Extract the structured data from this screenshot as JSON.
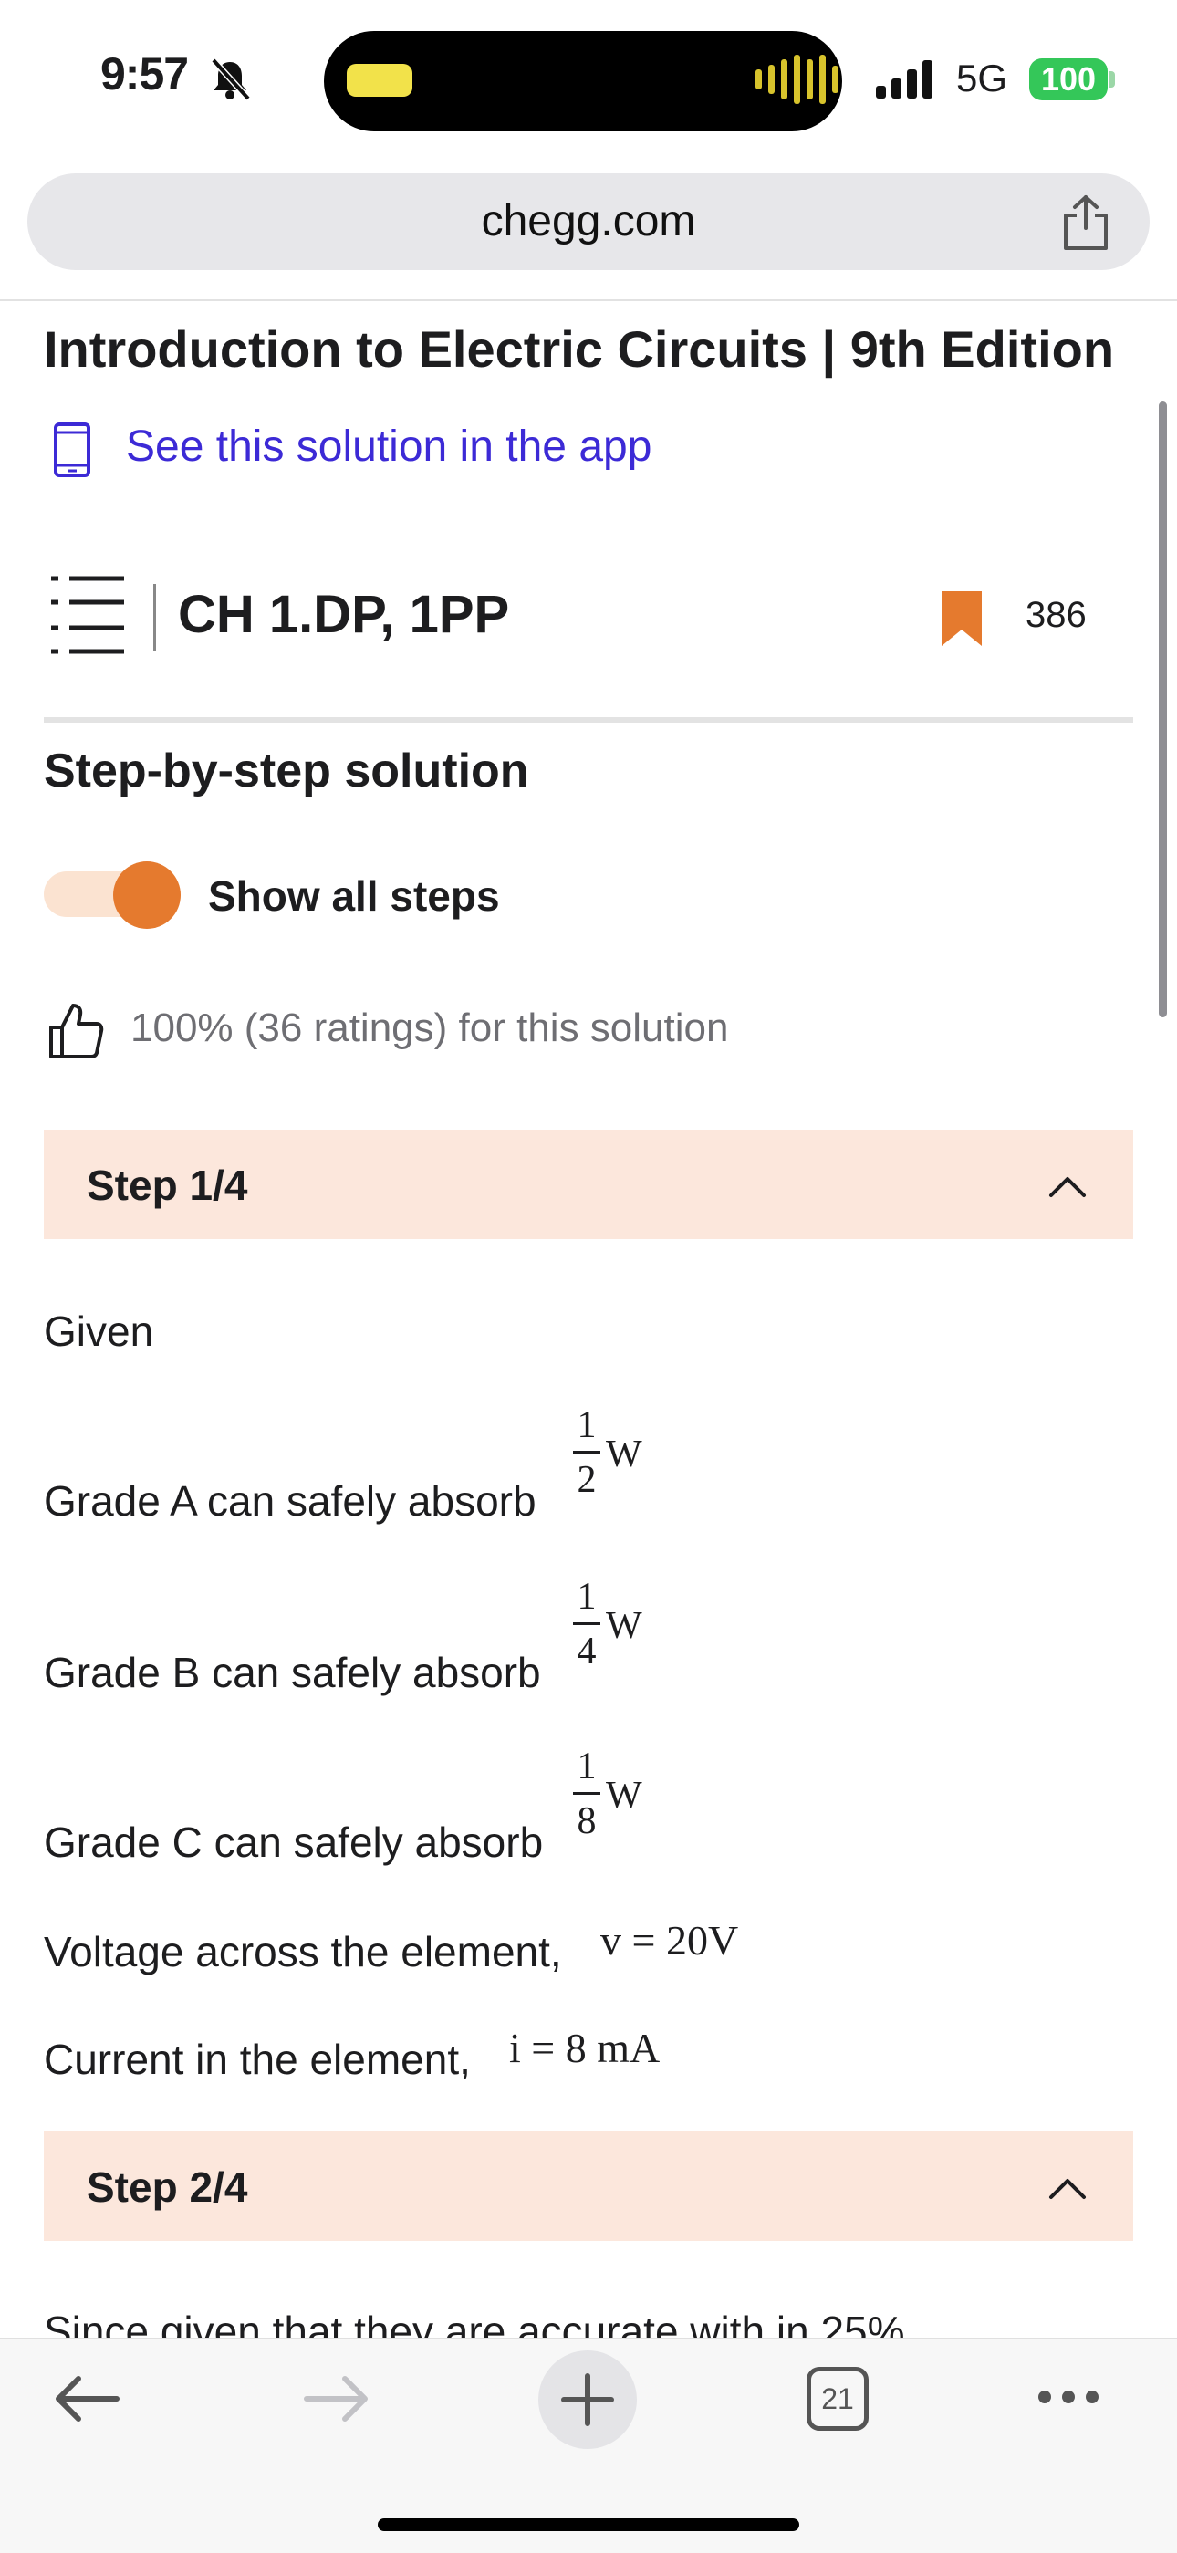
{
  "status_bar": {
    "time": "9:57",
    "network": "5G",
    "battery": "100"
  },
  "browser": {
    "url": "chegg.com",
    "tabs_count": "21"
  },
  "page": {
    "book_title": "Introduction to Electric Circuits | 9th Edition",
    "app_link": "See this solution in the app",
    "chapter": "CH 1.DP, 1PP",
    "bookmark_count": "386",
    "section_title": "Step-by-step solution",
    "show_all_steps_label": "Show all steps",
    "show_all_steps_on": true,
    "rating_text": "100% (36 ratings) for this solution"
  },
  "steps": [
    {
      "label": "Step 1/4",
      "lines": {
        "given": "Given",
        "grade_a": "Grade A can safely absorb",
        "grade_b": "Grade B can safely absorb",
        "grade_c": "Grade C can safely absorb",
        "voltage": "Voltage across the element,",
        "current": "Current in the element,"
      },
      "math": {
        "grade_a": {
          "num": "1",
          "den": "2",
          "unit": "W"
        },
        "grade_b": {
          "num": "1",
          "den": "4",
          "unit": "W"
        },
        "grade_c": {
          "num": "1",
          "den": "8",
          "unit": "W"
        },
        "voltage": "v = 20V",
        "current": "i = 8 mA"
      }
    },
    {
      "label": "Step 2/4",
      "preview": "Since given that they are accurate with in 25%"
    }
  ],
  "colors": {
    "accent": "#e57a2e",
    "step_header_bg": "#fce7dc",
    "link": "#3c2ad6",
    "battery": "#34c759"
  }
}
